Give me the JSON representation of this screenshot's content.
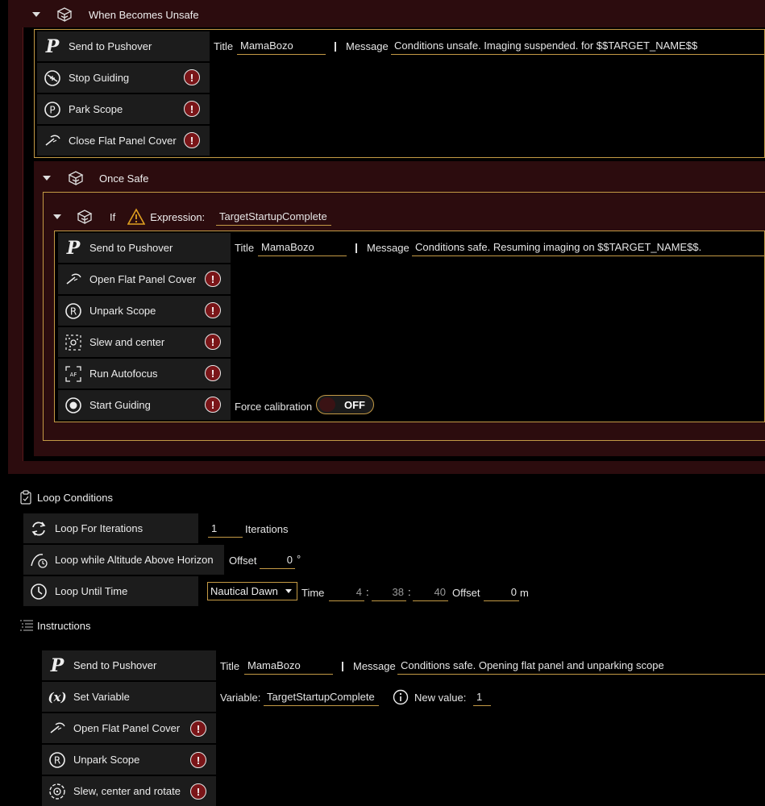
{
  "when_unsafe": {
    "title": "When Becomes Unsafe",
    "items": [
      {
        "label": "Send to Pushover"
      },
      {
        "label": "Stop Guiding"
      },
      {
        "label": "Park Scope"
      },
      {
        "label": "Close Flat Panel Cover"
      }
    ],
    "pushover": {
      "title_label": "Title",
      "title_value": "MamaBozo",
      "message_label": "Message",
      "message_value": "Conditions unsafe. Imaging suspended. for $$TARGET_NAME$$"
    }
  },
  "once_safe": {
    "title": "Once Safe",
    "if_block": {
      "label": "If",
      "expression_label": "Expression:",
      "expression_value": "TargetStartupComplete"
    },
    "items": [
      {
        "label": "Send to Pushover"
      },
      {
        "label": "Open Flat Panel Cover"
      },
      {
        "label": "Unpark Scope"
      },
      {
        "label": "Slew and center"
      },
      {
        "label": "Run Autofocus"
      },
      {
        "label": "Start Guiding"
      }
    ],
    "pushover": {
      "title_label": "Title",
      "title_value": "MamaBozo",
      "message_label": "Message",
      "message_value": "Conditions safe. Resuming imaging on $$TARGET_NAME$$."
    },
    "force_calibration": {
      "label": "Force calibration",
      "state": "OFF"
    }
  },
  "loop_conditions": {
    "title": "Loop Conditions",
    "for_iterations": {
      "label": "Loop For Iterations",
      "value": "1",
      "unit": "Iterations"
    },
    "altitude": {
      "label": "Loop while Altitude Above Horizon",
      "offset_label": "Offset",
      "offset_value": "0",
      "unit": "°"
    },
    "until_time": {
      "label": "Loop Until Time",
      "mode": "Nautical Dawn",
      "time_label": "Time",
      "hours": "4",
      "minutes": "38",
      "seconds": "40",
      "colon": ":",
      "offset_label": "Offset",
      "offset_value": "0",
      "offset_unit": "m"
    }
  },
  "instructions": {
    "title": "Instructions",
    "items": [
      {
        "label": "Send to Pushover"
      },
      {
        "label": "Set Variable"
      },
      {
        "label": "Open Flat Panel Cover"
      },
      {
        "label": "Unpark Scope"
      },
      {
        "label": "Slew, center and rotate"
      }
    ],
    "pushover": {
      "title_label": "Title",
      "title_value": "MamaBozo",
      "message_label": "Message",
      "message_value": "Conditions safe. Opening flat panel and unparking scope"
    },
    "set_variable": {
      "variable_label": "Variable:",
      "variable_value": "TargetStartupComplete",
      "new_value_label": "New value:",
      "new_value": "1"
    }
  },
  "error_glyph": "!",
  "colors": {
    "accent": "#c49a45",
    "band": "#2c0c0e",
    "error": "#7a1518"
  }
}
